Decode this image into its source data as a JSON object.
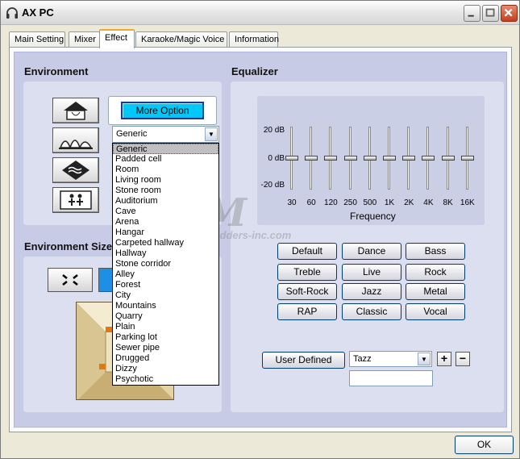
{
  "window": {
    "title": "AX PC"
  },
  "tabs": [
    {
      "label": "Main Setting",
      "active": false
    },
    {
      "label": "Mixer",
      "active": false
    },
    {
      "label": "Effect",
      "active": true
    },
    {
      "label": "Karaoke/Magic Voice",
      "active": false
    },
    {
      "label": "Information",
      "active": false
    }
  ],
  "environment": {
    "title": "Environment",
    "more_option_label": "More Option",
    "selected": "Generic",
    "options": [
      "Generic",
      "Padded cell",
      "Room",
      "Living room",
      "Stone room",
      "Auditorium",
      "Cave",
      "Arena",
      "Hangar",
      "Carpeted hallway",
      "Hallway",
      "Stone corridor",
      "Alley",
      "Forest",
      "City",
      "Mountains",
      "Quarry",
      "Plain",
      "Parking lot",
      "Sewer pipe",
      "Drugged",
      "Dizzy",
      "Psychotic"
    ],
    "icons": [
      "house-icon",
      "concert-hall-icon",
      "underwater-icon",
      "room-people-icon"
    ]
  },
  "environment_size": {
    "title": "Environment Size"
  },
  "equalizer": {
    "title": "Equalizer",
    "db_labels": [
      "20 dB",
      "0 dB",
      "-20 dB"
    ],
    "db_values": [
      0,
      0,
      0,
      0,
      0,
      0,
      0,
      0,
      0,
      0
    ],
    "frequencies": [
      "30",
      "60",
      "120",
      "250",
      "500",
      "1K",
      "2K",
      "4K",
      "8K",
      "16K"
    ],
    "frequency_label": "Frequency",
    "presets": [
      "Default",
      "Dance",
      "Bass",
      "Treble",
      "Live",
      "Rock",
      "Soft-Rock",
      "Jazz",
      "Metal",
      "RAP",
      "Classic",
      "Vocal"
    ],
    "user_defined_label": "User  Defined",
    "user_preset_selected": "Tazz",
    "plus_label": "+",
    "minus_label": "−"
  },
  "footer": {
    "ok_label": "OK"
  },
  "watermark": {
    "big": "M",
    "small": "modders-inc.com"
  }
}
